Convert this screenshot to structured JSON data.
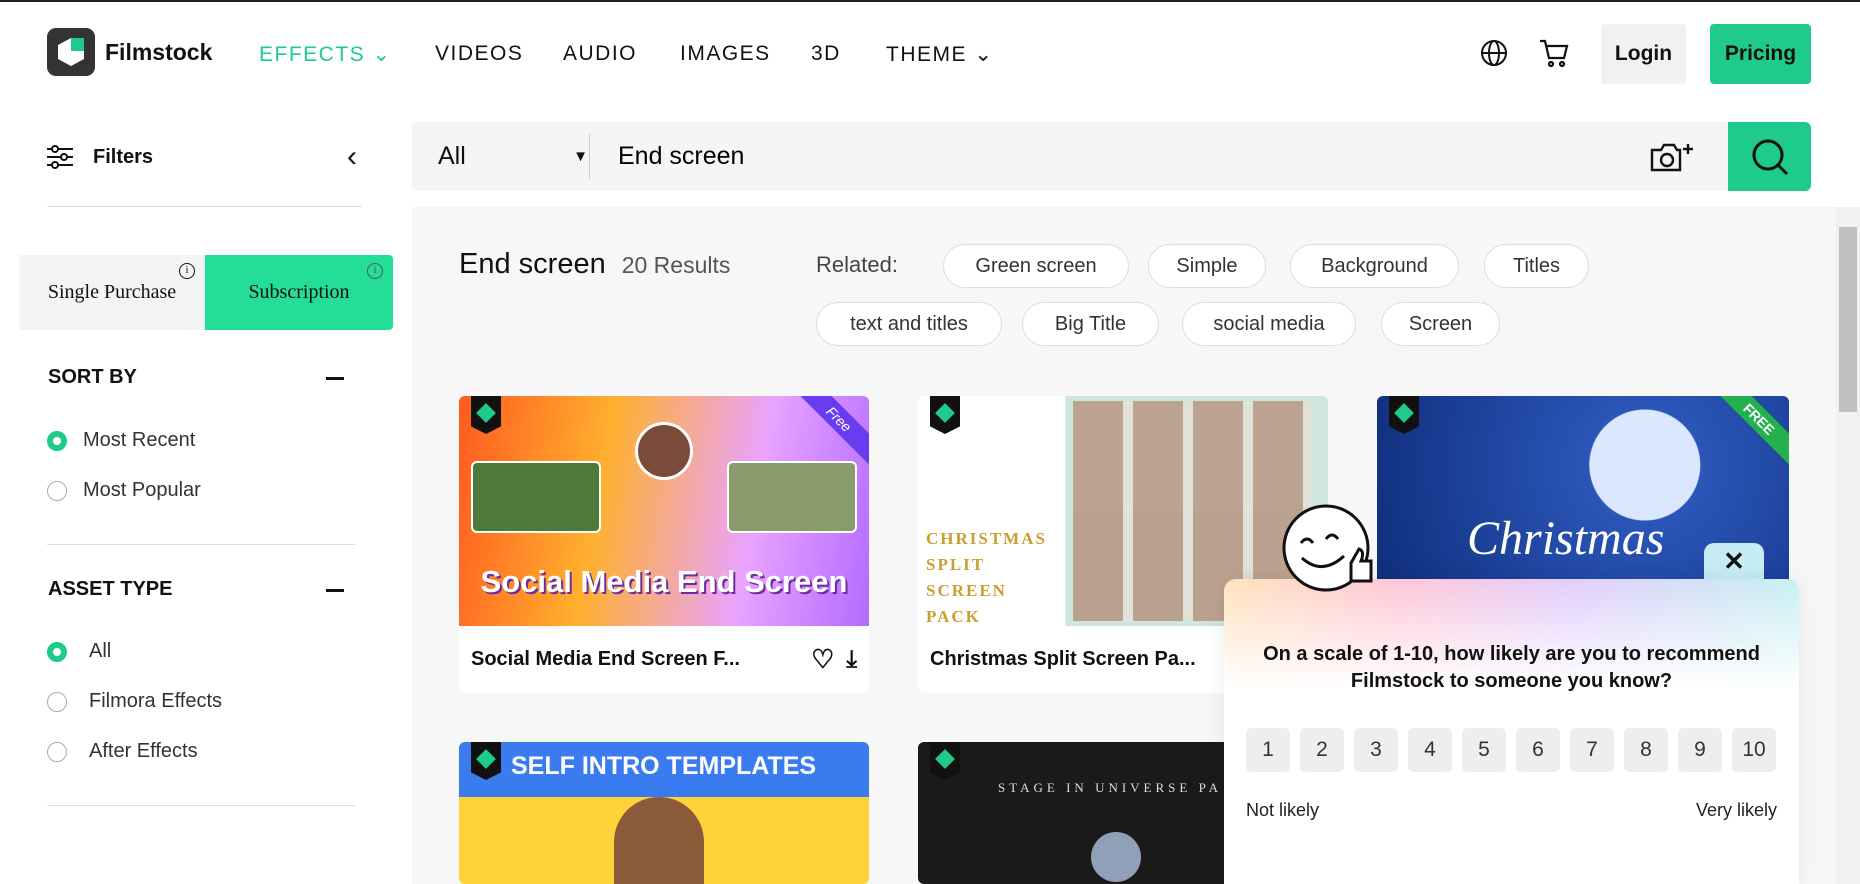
{
  "header": {
    "brand": "Filmstock",
    "nav": [
      {
        "label": "EFFECTS",
        "active": true
      },
      {
        "label": "VIDEOS"
      },
      {
        "label": "AUDIO"
      },
      {
        "label": "IMAGES"
      },
      {
        "label": "3D"
      },
      {
        "label": "THEME"
      }
    ],
    "login": "Login",
    "pricing": "Pricing",
    "accent": "#1fcb8a"
  },
  "sidebar": {
    "filters": "Filters",
    "single_purchase": "Single Purchase",
    "subscription": "Subscription",
    "sort_by": "SORT BY",
    "sort_options": [
      {
        "label": "Most Recent",
        "selected": true
      },
      {
        "label": "Most Popular",
        "selected": false
      }
    ],
    "asset_type": "ASSET TYPE",
    "asset_options": [
      {
        "label": "All",
        "selected": true
      },
      {
        "label": "Filmora Effects",
        "selected": false
      },
      {
        "label": "After Effects",
        "selected": false
      }
    ]
  },
  "search": {
    "category": "All",
    "query": "End screen"
  },
  "results": {
    "title": "End screen",
    "count": "20 Results",
    "related_label": "Related:",
    "related": [
      "Green screen",
      "Simple",
      "Background",
      "Titles",
      "text and titles",
      "Big Title",
      "social media",
      "Screen"
    ]
  },
  "cards": [
    {
      "title": "Social Media End Screen F...",
      "image_text": "Social Media End Screen",
      "ribbon": "Free"
    },
    {
      "title": "Christmas Split Screen Pa...",
      "image_text": "CHRISTMAS SPLIT SCREEN PACK"
    },
    {
      "title": "",
      "image_text": "Christmas",
      "ribbon": "FREE"
    },
    {
      "title": "",
      "image_text": "SELF INTRO TEMPLATES"
    },
    {
      "title": "",
      "image_text": "STAGE IN UNIVERSE PA"
    }
  ],
  "survey": {
    "question": "On a scale of 1-10, how likely are you to recommend Filmstock to someone you know?",
    "scale": [
      "1",
      "2",
      "3",
      "4",
      "5",
      "6",
      "7",
      "8",
      "9",
      "10"
    ],
    "low_label": "Not likely",
    "high_label": "Very likely"
  }
}
